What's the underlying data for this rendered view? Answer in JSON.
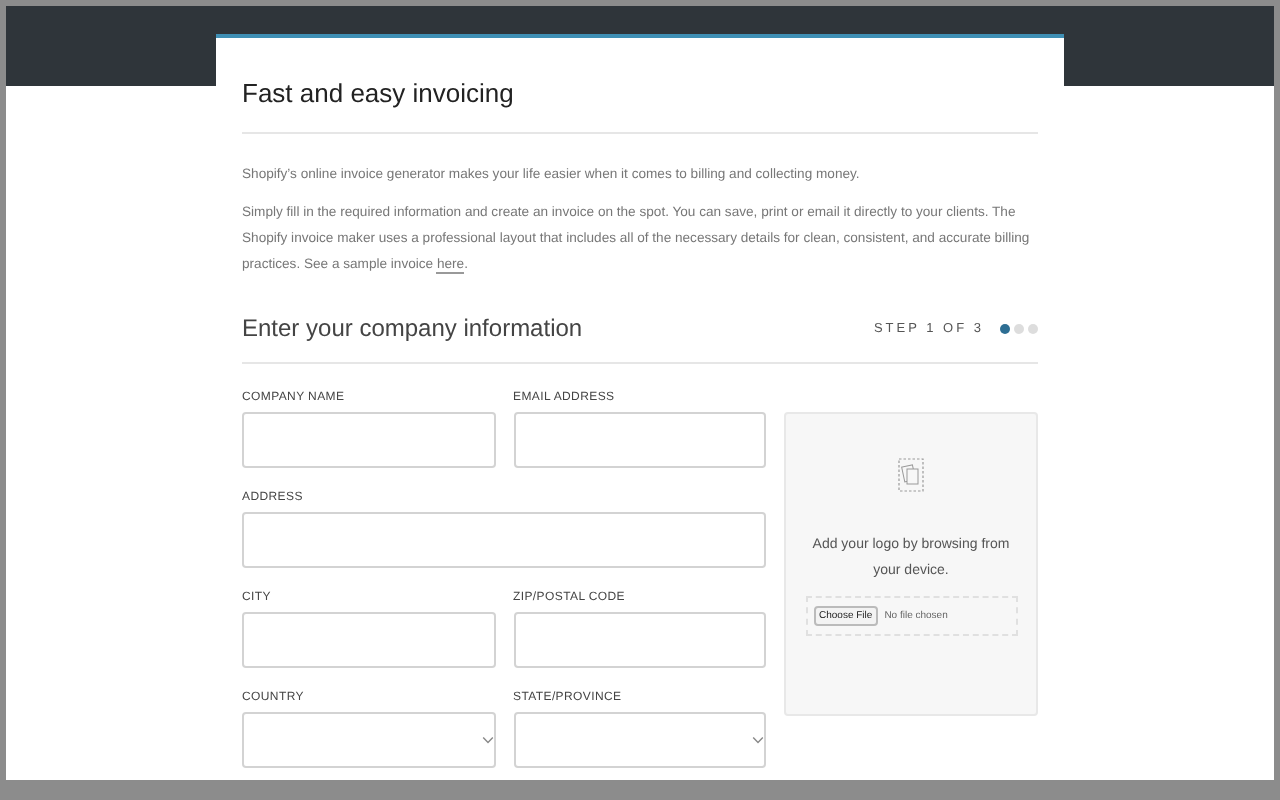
{
  "page": {
    "title": "Fast and easy invoicing",
    "intro": "Shopify’s online invoice generator makes your life easier when it comes to billing and collecting money.",
    "body": "Simply fill in the required information and create an invoice on the spot. You can save, print or email it directly to your clients. The Shopify invoice maker uses a professional layout that includes all of the necessary details for clean, consistent, and accurate billing practices. See a sample invoice",
    "link": "here",
    "link_tail": "."
  },
  "section": {
    "heading": "Enter your company information",
    "step_label": "STEP 1 OF 3",
    "steps": [
      {
        "selected": true
      },
      {
        "selected": false
      },
      {
        "selected": false
      }
    ]
  },
  "field_rows": [
    [
      {
        "label": "COMPANY NAME",
        "kind": "input"
      },
      {
        "label": "EMAIL ADDRESS",
        "kind": "input"
      }
    ],
    [
      {
        "label": "ADDRESS",
        "kind": "input"
      }
    ],
    [
      {
        "label": "CITY",
        "kind": "input"
      },
      {
        "label": "ZIP/POSTAL CODE",
        "kind": "input"
      }
    ],
    [
      {
        "label": "COUNTRY",
        "kind": "select"
      },
      {
        "label": "STATE/PROVINCE",
        "kind": "select"
      }
    ]
  ],
  "logo_upload": {
    "text": "Add your logo by browsing from your device.",
    "button": "Choose File",
    "status": "No file chosen"
  }
}
